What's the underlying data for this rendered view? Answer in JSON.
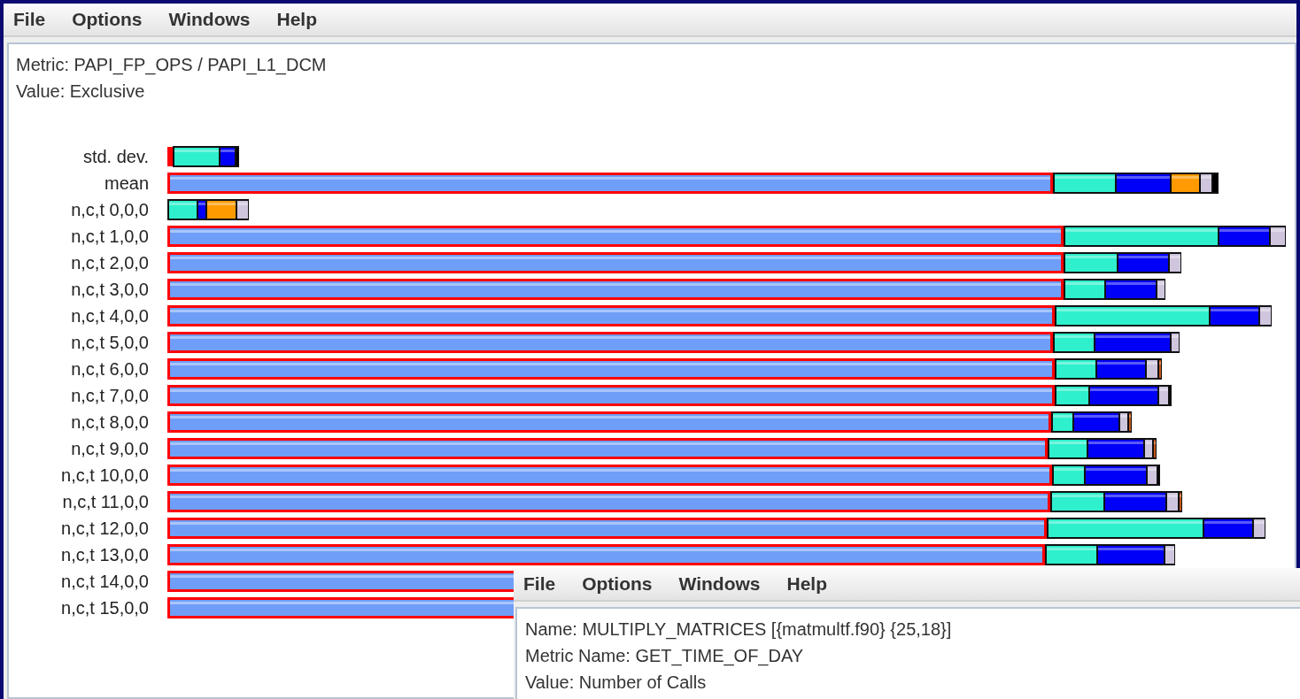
{
  "main_window": {
    "menu": [
      "File",
      "Options",
      "Windows",
      "Help"
    ],
    "info_lines": [
      "Metric: PAPI_FP_OPS / PAPI_L1_DCM",
      "Value: Exclusive"
    ],
    "rows": [
      {
        "label": "std. dev."
      },
      {
        "label": "mean"
      },
      {
        "label": "n,c,t 0,0,0"
      },
      {
        "label": "n,c,t 1,0,0"
      },
      {
        "label": "n,c,t 2,0,0"
      },
      {
        "label": "n,c,t 3,0,0"
      },
      {
        "label": "n,c,t 4,0,0"
      },
      {
        "label": "n,c,t 5,0,0"
      },
      {
        "label": "n,c,t 6,0,0"
      },
      {
        "label": "n,c,t 7,0,0"
      },
      {
        "label": "n,c,t 8,0,0"
      },
      {
        "label": "n,c,t 9,0,0"
      },
      {
        "label": "n,c,t 10,0,0"
      },
      {
        "label": "n,c,t 11,0,0"
      },
      {
        "label": "n,c,t 12,0,0"
      },
      {
        "label": "n,c,t 13,0,0"
      },
      {
        "label": "n,c,t 14,0,0"
      },
      {
        "label": "n,c,t 15,0,0"
      }
    ]
  },
  "popup_window": {
    "menu": [
      "File",
      "Options",
      "Windows",
      "Help"
    ],
    "info_lines": [
      "Name: MULTIPLY_MATRICES [{matmultf.f90} {25,18}]",
      "Metric Name: GET_TIME_OF_DAY",
      "Value: Number of Calls"
    ]
  }
}
